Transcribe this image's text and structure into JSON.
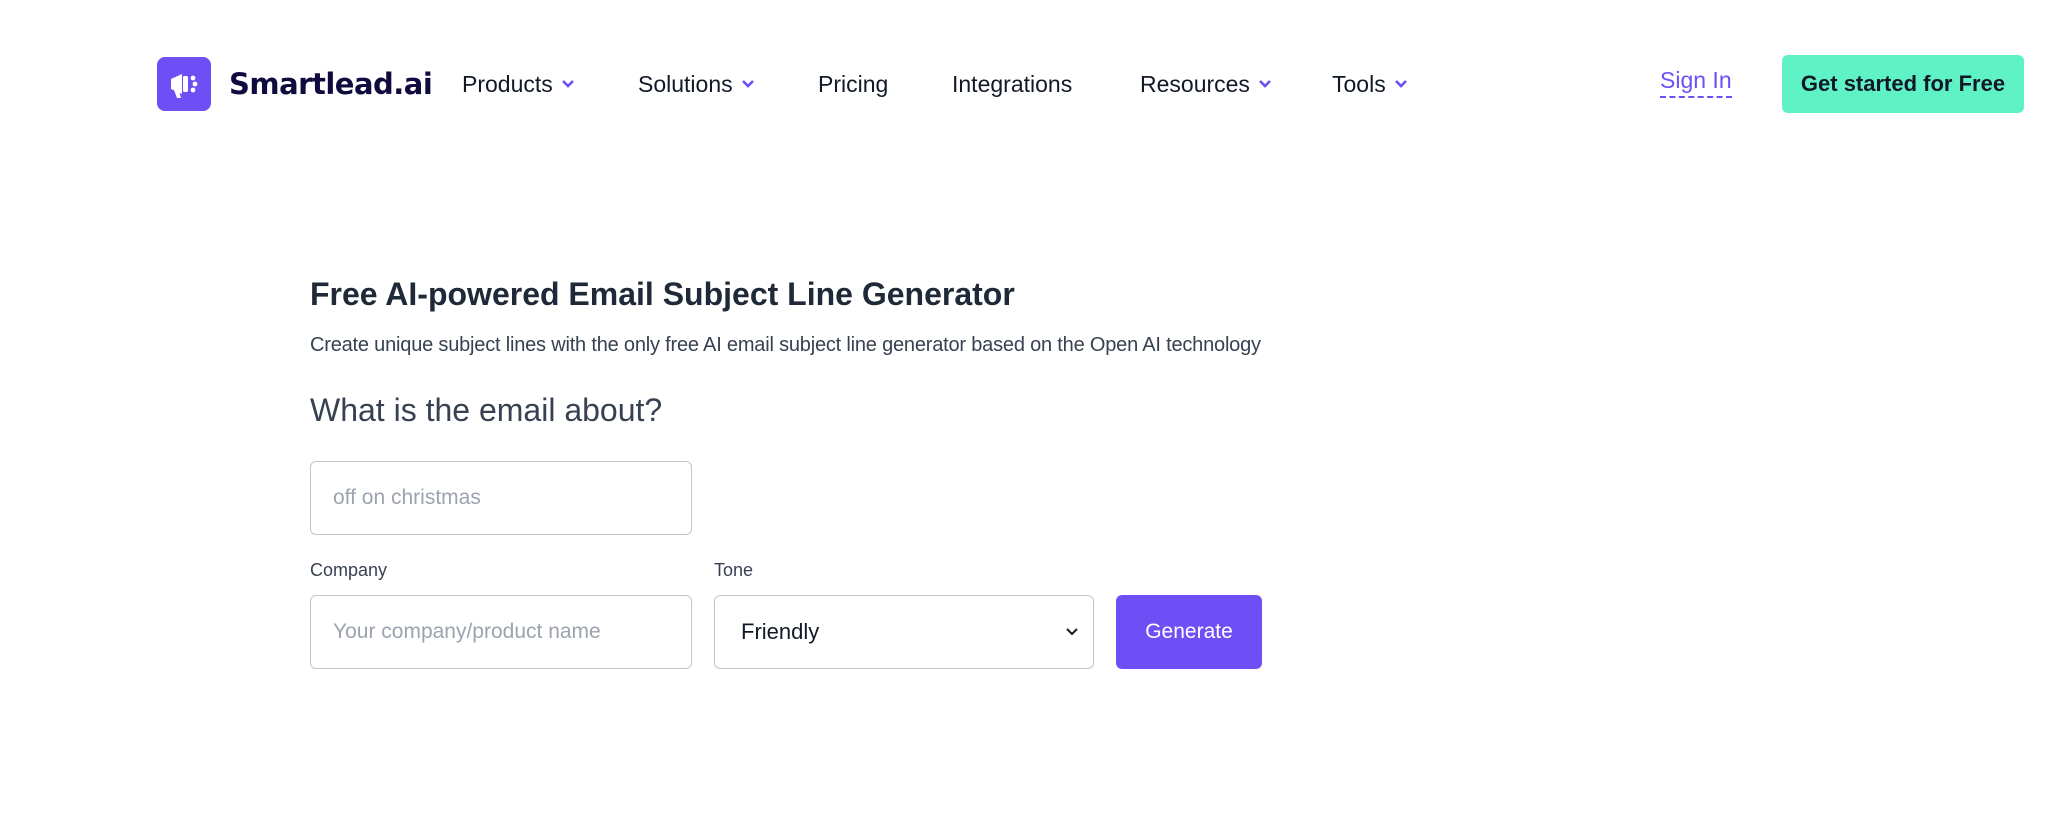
{
  "brand": {
    "name": "Smartlead.ai",
    "logo_icon": "megaphone-icon",
    "accent_color": "#6e4ff6",
    "cta_color": "#5ff2c4"
  },
  "nav": {
    "items": [
      {
        "label": "Products",
        "has_dropdown": true
      },
      {
        "label": "Solutions",
        "has_dropdown": true
      },
      {
        "label": "Pricing",
        "has_dropdown": false
      },
      {
        "label": "Integrations",
        "has_dropdown": false
      },
      {
        "label": "Resources",
        "has_dropdown": true
      },
      {
        "label": "Tools",
        "has_dropdown": true
      }
    ],
    "sign_in": "Sign In",
    "cta": "Get started for Free"
  },
  "main": {
    "title": "Free AI-powered Email Subject Line Generator",
    "subtitle": "Create unique subject lines with the only free AI email subject line generator based on the Open AI technology",
    "question": "What is the email about?",
    "topic_input": {
      "value": "",
      "placeholder": "off on christmas"
    },
    "company_label": "Company",
    "company_input": {
      "value": "",
      "placeholder": "Your company/product name"
    },
    "tone_label": "Tone",
    "tone_selected": "Friendly",
    "generate_label": "Generate"
  }
}
